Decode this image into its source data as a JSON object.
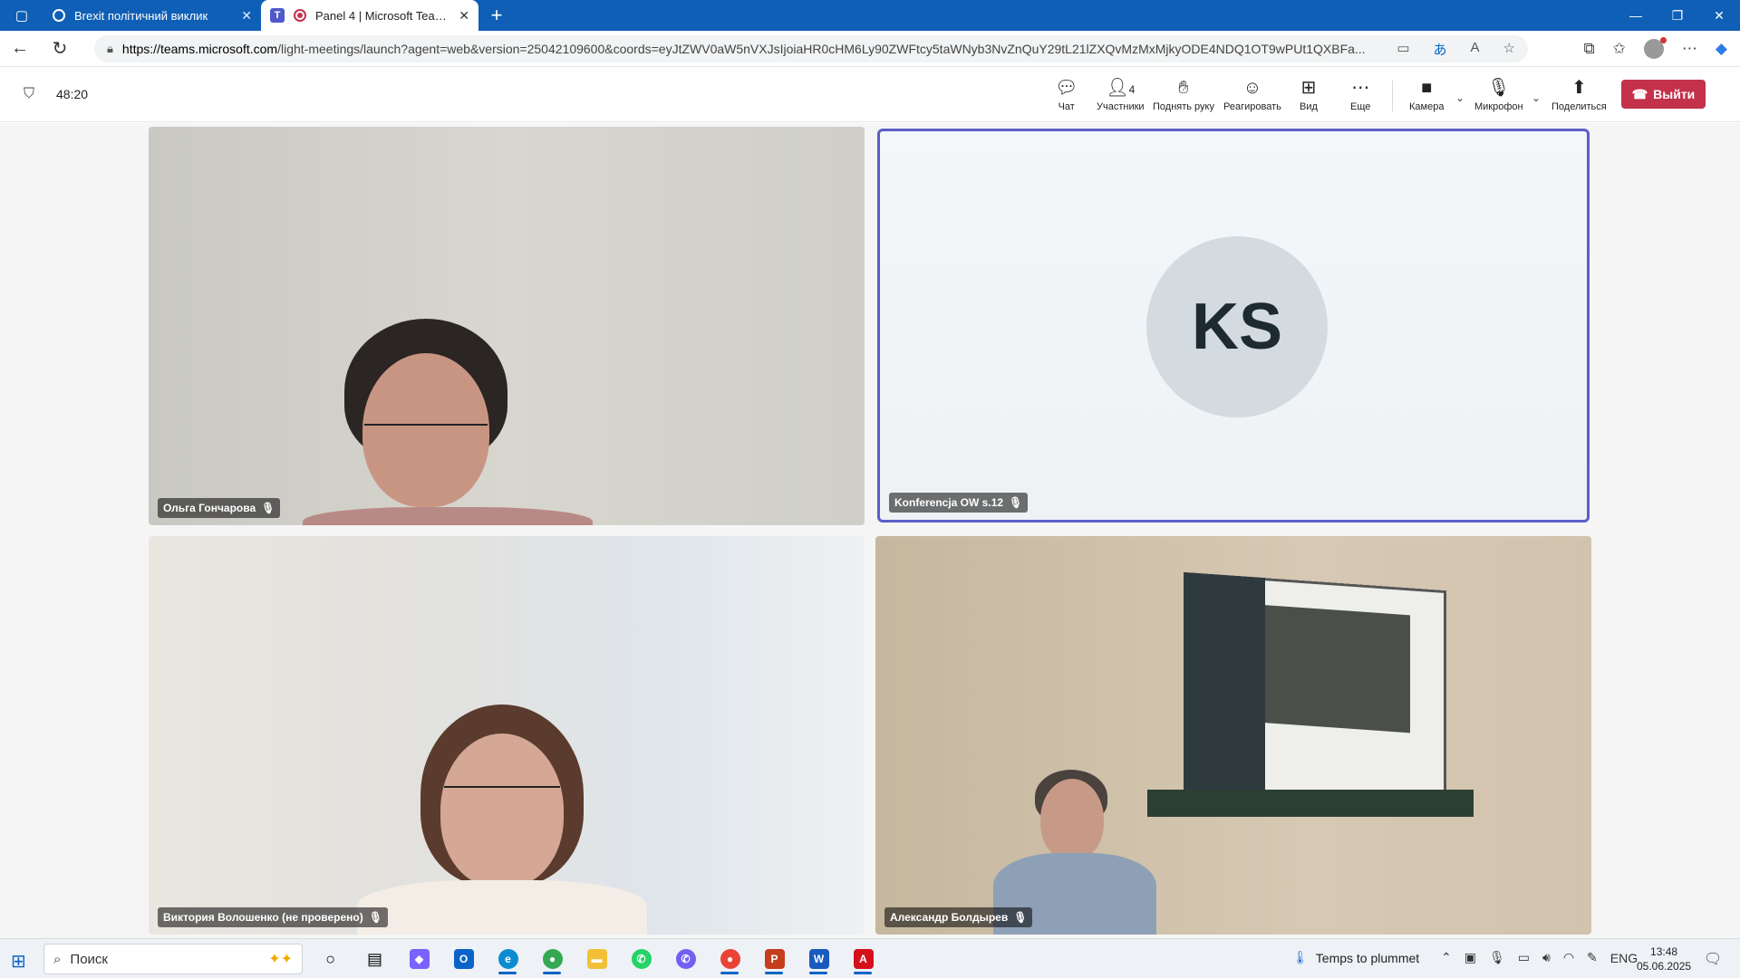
{
  "browser": {
    "tabs": [
      {
        "title": "Brexit політичний виклик"
      },
      {
        "title": "Panel 4 | Microsoft Teams"
      }
    ],
    "url_host": "https://teams.microsoft.com",
    "url_rest": "/light-meetings/launch?agent=web&version=25042109600&coords=eyJtZWV0aW5nVXJsIjoiaHR0cHM6Ly90ZWFtcy5taWNyb3NvZnQuY29tL21lZXQvMzMxMjkyODE4NDQ1OT9wPUt1QXBFa..."
  },
  "meeting": {
    "timer": "48:20",
    "toolbar": {
      "chat": "Чат",
      "participants": "Участники",
      "participants_count": "4",
      "raise_hand": "Поднять руку",
      "react": "Реагировать",
      "view": "Вид",
      "more": "Еще",
      "camera": "Камера",
      "mic": "Микрофон",
      "share": "Поделиться",
      "leave": "Выйти"
    },
    "participants": [
      {
        "name": "Ольга Гончарова"
      },
      {
        "name": "Konferencja OW s.12",
        "initials": "KS"
      },
      {
        "name": "Виктория Волошенко (не проверено)"
      },
      {
        "name": "Александр Болдырев"
      }
    ]
  },
  "taskbar": {
    "search_placeholder": "Поиск",
    "weather": "Temps to plummet",
    "lang": "ENG",
    "time": "13:48",
    "date": "05.06.2025"
  }
}
